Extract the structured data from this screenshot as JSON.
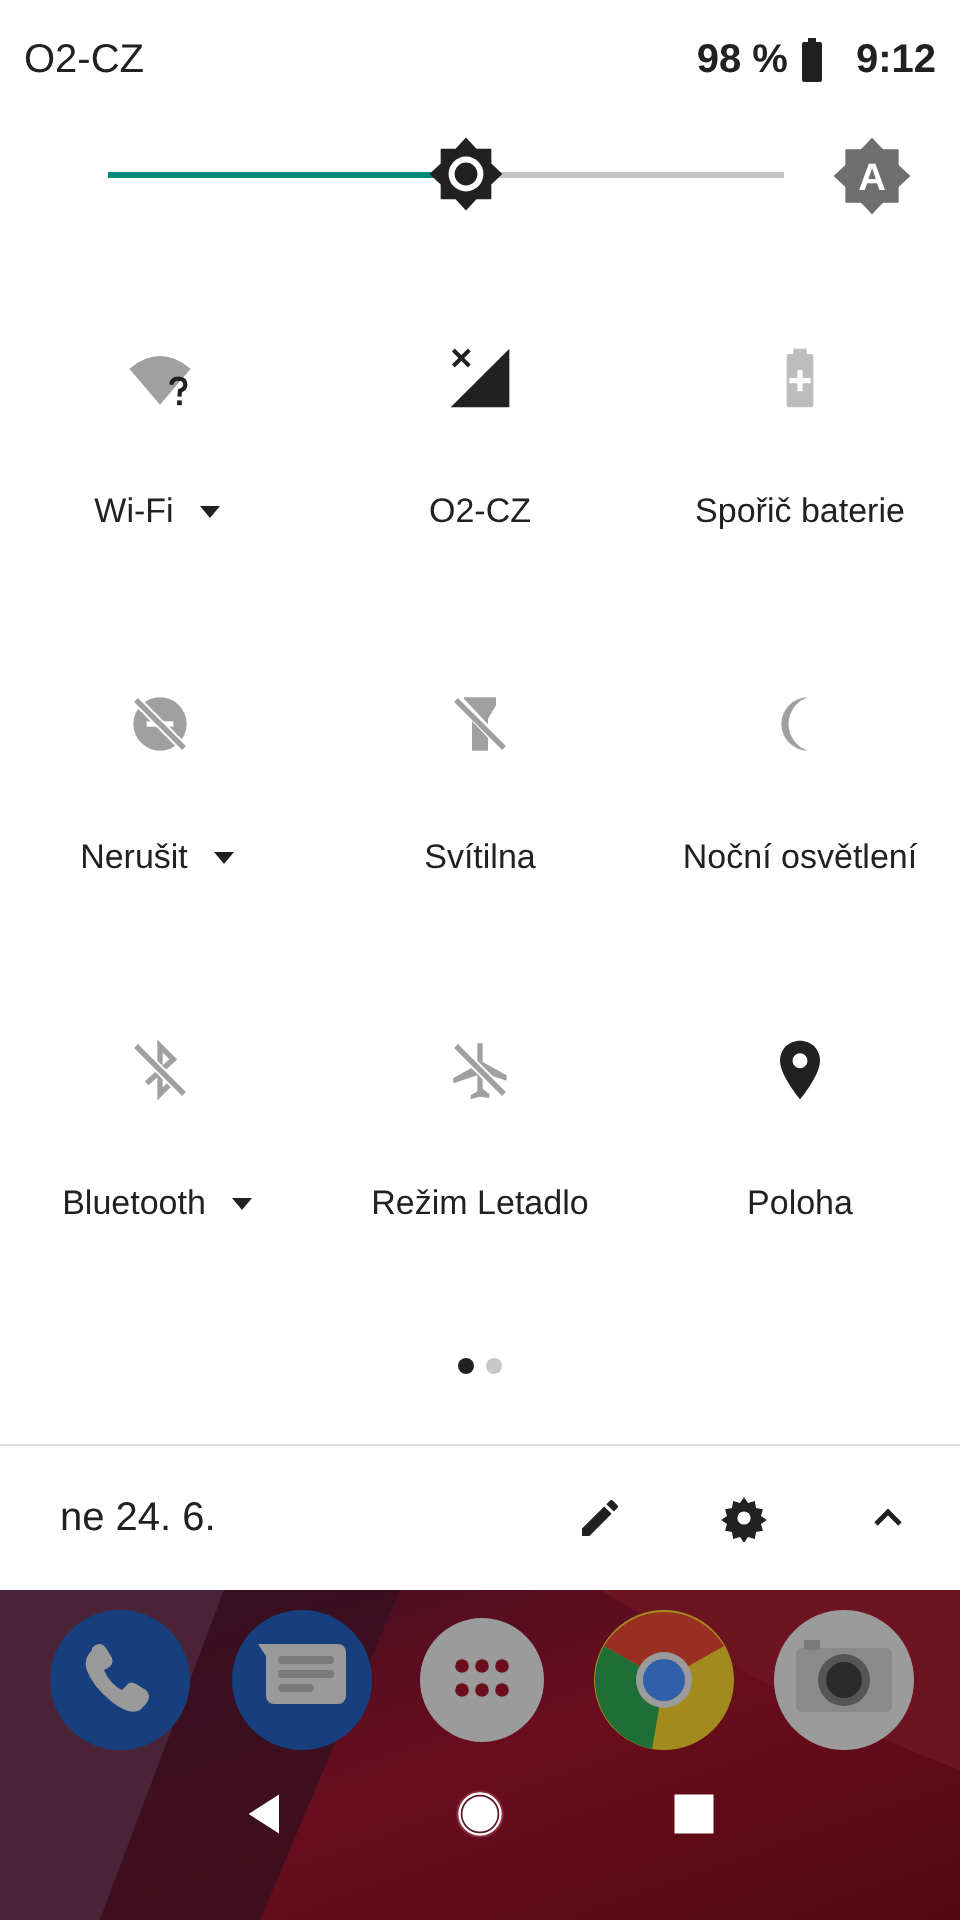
{
  "status_bar": {
    "carrier": "O2-CZ",
    "battery": "98 %",
    "time": "9:12"
  },
  "brightness": {
    "level": 0.53,
    "auto_letter": "A"
  },
  "tiles": [
    {
      "label": "Wi-Fi",
      "kind": "wifi",
      "on": false,
      "dropdown": true
    },
    {
      "label": "O2-CZ",
      "kind": "cellular",
      "on": true,
      "dropdown": false
    },
    {
      "label": "Spořič baterie",
      "kind": "battery",
      "on": false,
      "dropdown": false
    },
    {
      "label": "Nerušit",
      "kind": "dnd",
      "on": false,
      "dropdown": true
    },
    {
      "label": "Svítilna",
      "kind": "flashlight",
      "on": false,
      "dropdown": false
    },
    {
      "label": "Noční osvětlení",
      "kind": "night",
      "on": false,
      "dropdown": false
    },
    {
      "label": "Bluetooth",
      "kind": "bluetooth",
      "on": false,
      "dropdown": true
    },
    {
      "label": "Režim Letadlo",
      "kind": "airplane",
      "on": false,
      "dropdown": false
    },
    {
      "label": "Poloha",
      "kind": "location",
      "on": true,
      "dropdown": false
    }
  ],
  "pages": [
    {
      "selected": true
    },
    {
      "selected": false
    }
  ],
  "footer": {
    "date": "ne 24. 6."
  },
  "dock": [
    {
      "kind": "phone"
    },
    {
      "kind": "messages"
    },
    {
      "kind": "apps"
    },
    {
      "kind": "browser"
    },
    {
      "kind": "camera"
    }
  ]
}
